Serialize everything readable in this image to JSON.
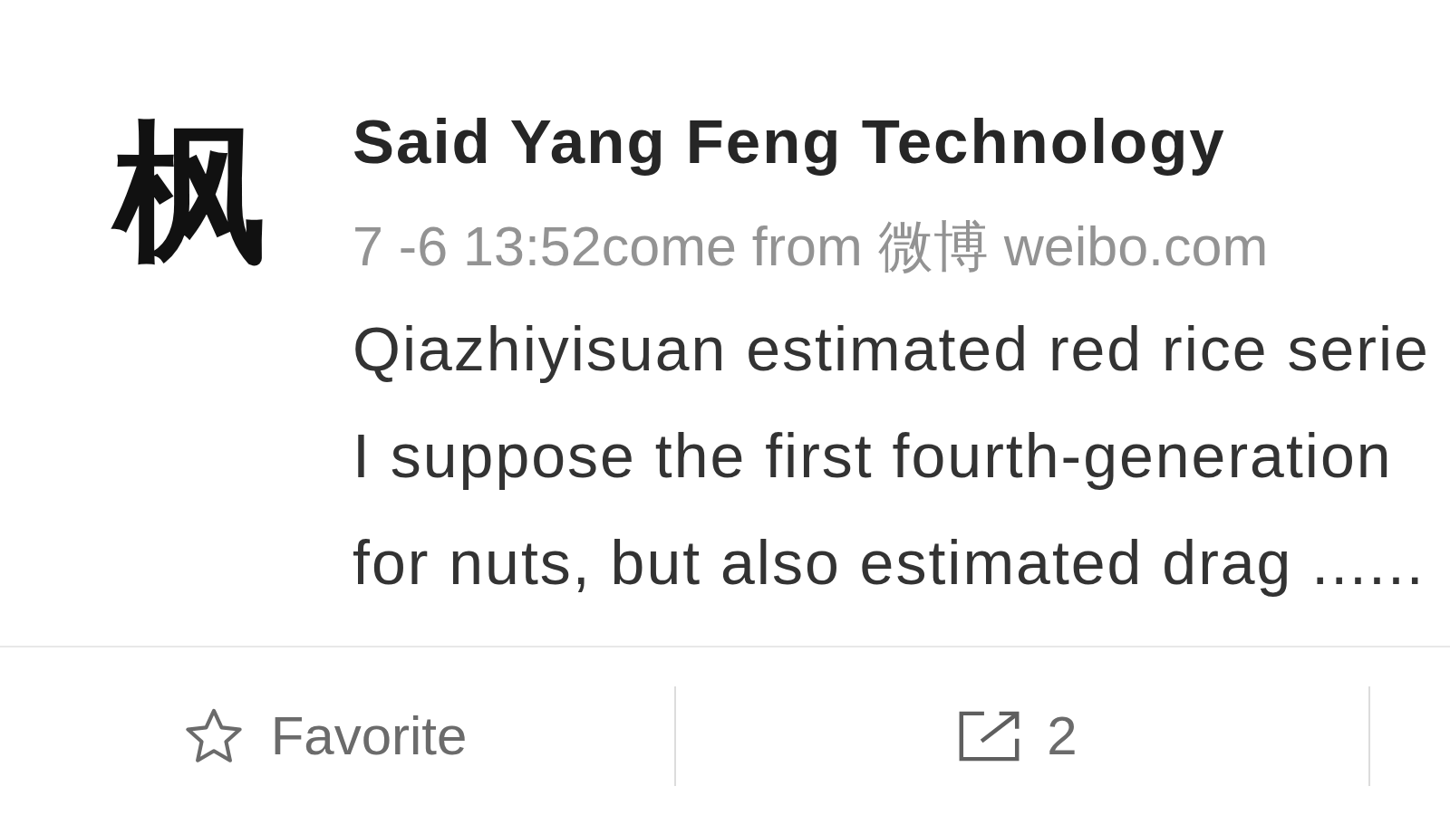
{
  "post": {
    "avatar": {
      "glyph": "枫"
    },
    "author": "Said Yang Feng Technology",
    "meta": "7 -6 13:52come from 微博 weibo.com",
    "text_lines": [
      "Qiazhiyisuan estimated red rice serie",
      "I suppose the first fourth-generation",
      "for nuts, but also estimated drag ......"
    ]
  },
  "actions": [
    {
      "kind": "favorite",
      "label": "Favorite"
    },
    {
      "kind": "share",
      "label": "2"
    }
  ]
}
